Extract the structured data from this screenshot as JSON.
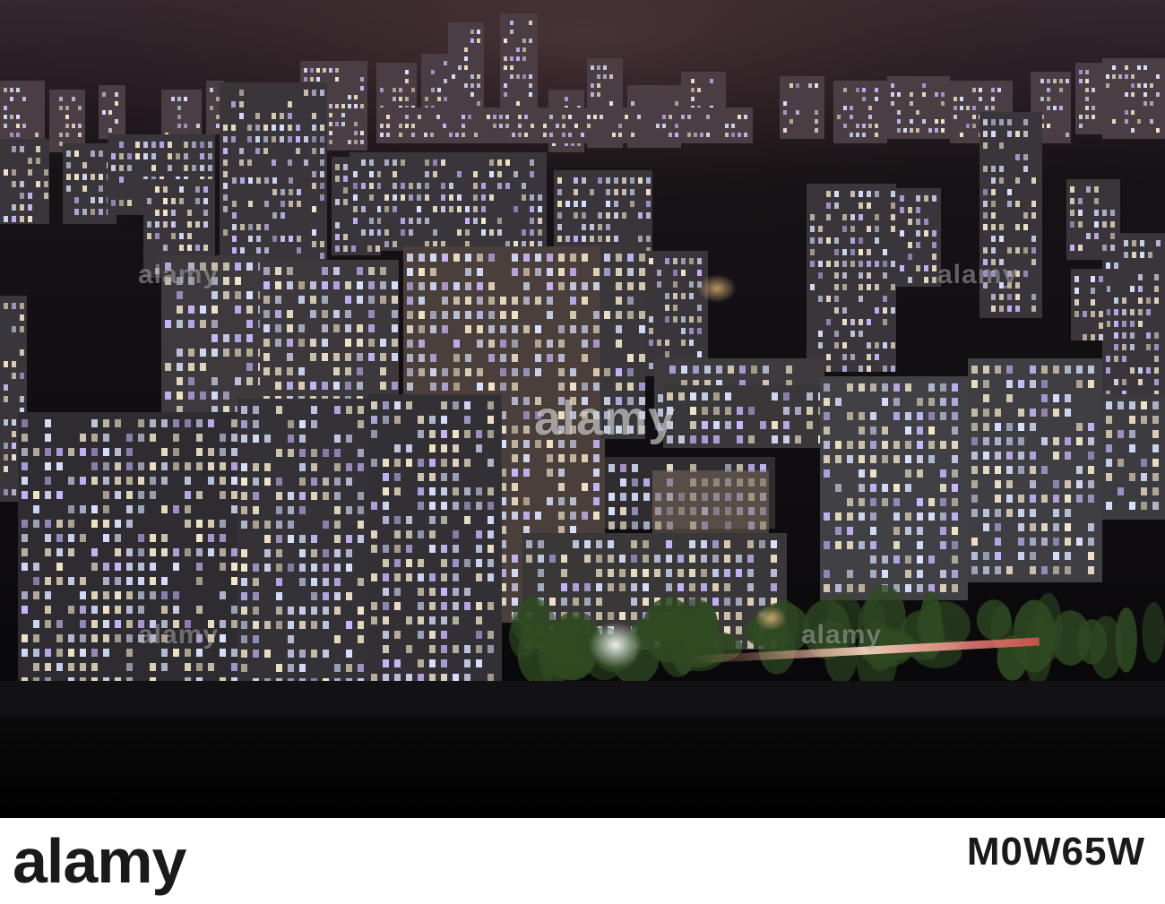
{
  "photo": {
    "subject": "",
    "palette": {
      "sky": "#3a2c34",
      "building": "#3b373c",
      "window_warm": "#f2e6c8",
      "window_cool": "#d8e2ff",
      "window_violet": "#c8b8ff",
      "street_light": "#fff2d6",
      "trees": "#2f4a22",
      "river": "#030303"
    }
  },
  "watermark": {
    "main": "alamy",
    "small_1": "alamy",
    "small_2": "alamy",
    "small_3": "alamy",
    "small_4": "alamy"
  },
  "stock_bar": {
    "logo_text": "alamy",
    "site_text": "",
    "image_id": "M0W65W"
  }
}
